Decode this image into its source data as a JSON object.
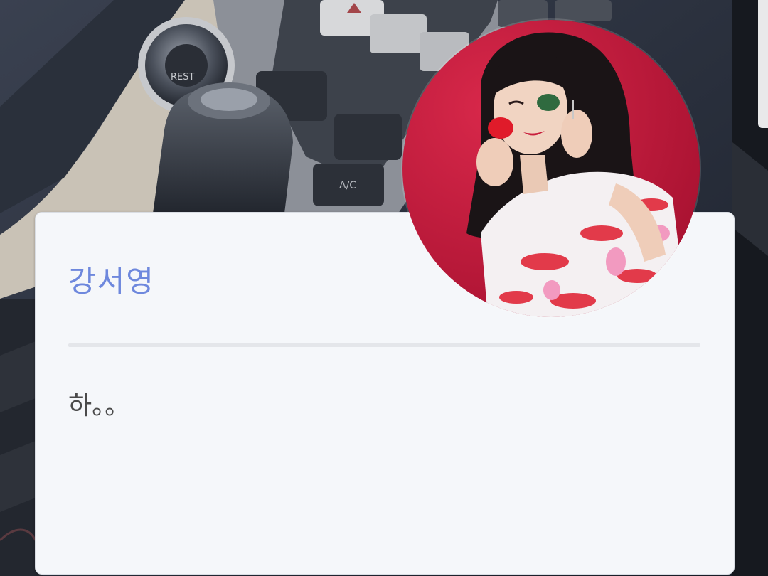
{
  "profile": {
    "name": "강서영",
    "status_message": "하。。"
  },
  "colors": {
    "name_accent": "#6e88dd",
    "card_background": "#f5f7fa",
    "avatar_background": "#c4143a"
  }
}
